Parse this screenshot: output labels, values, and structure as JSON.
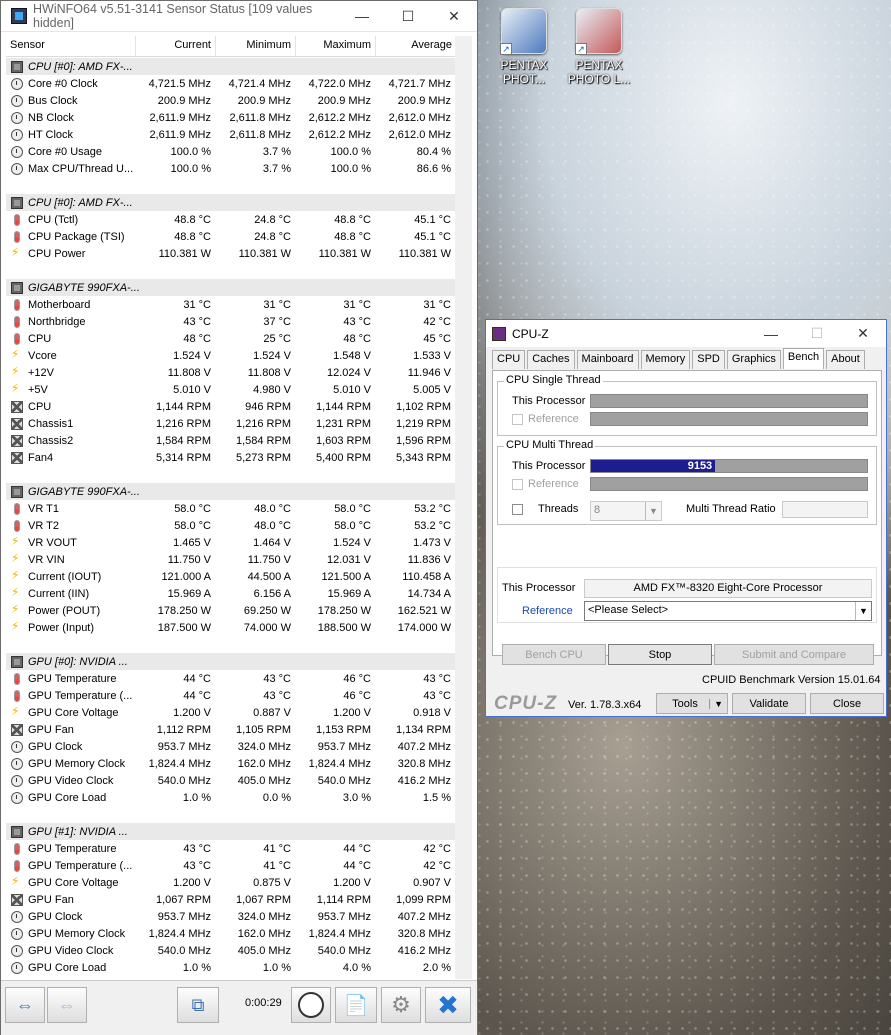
{
  "desktop": {
    "icons": [
      {
        "label": "PENTAX PHOT...",
        "color": "#4c7bbd"
      },
      {
        "label": "PENTAX PHOTO L...",
        "color": "#c45a5a"
      }
    ]
  },
  "hwinfo": {
    "title": "HWiNFO64 v5.51-3141 Sensor Status [109 values hidden]",
    "columns": [
      "Sensor",
      "Current",
      "Minimum",
      "Maximum",
      "Average"
    ],
    "rows": [
      {
        "type": "group",
        "name": "CPU [#0]: AMD FX-..."
      },
      {
        "icon": "clock",
        "name": "Core #0 Clock",
        "cur": "4,721.5 MHz",
        "min": "4,721.4 MHz",
        "max": "4,722.0 MHz",
        "avg": "4,721.7 MHz"
      },
      {
        "icon": "clock",
        "name": "Bus Clock",
        "cur": "200.9 MHz",
        "min": "200.9 MHz",
        "max": "200.9 MHz",
        "avg": "200.9 MHz"
      },
      {
        "icon": "clock",
        "name": "NB Clock",
        "cur": "2,611.9 MHz",
        "min": "2,611.8 MHz",
        "max": "2,612.2 MHz",
        "avg": "2,612.0 MHz"
      },
      {
        "icon": "clock",
        "name": "HT Clock",
        "cur": "2,611.9 MHz",
        "min": "2,611.8 MHz",
        "max": "2,612.2 MHz",
        "avg": "2,612.0 MHz"
      },
      {
        "icon": "clock",
        "name": "Core #0 Usage",
        "cur": "100.0 %",
        "min": "3.7 %",
        "max": "100.0 %",
        "avg": "80.4 %"
      },
      {
        "icon": "clock",
        "name": "Max CPU/Thread U...",
        "cur": "100.0 %",
        "min": "3.7 %",
        "max": "100.0 %",
        "avg": "86.6 %"
      },
      {
        "type": "spacer"
      },
      {
        "type": "group",
        "name": "CPU [#0]: AMD FX-..."
      },
      {
        "icon": "temp",
        "name": "CPU (Tctl)",
        "cur": "48.8 °C",
        "min": "24.8 °C",
        "max": "48.8 °C",
        "avg": "45.1 °C"
      },
      {
        "icon": "temp",
        "name": "CPU Package (TSI)",
        "cur": "48.8 °C",
        "min": "24.8 °C",
        "max": "48.8 °C",
        "avg": "45.1 °C"
      },
      {
        "icon": "volt",
        "name": "CPU Power",
        "cur": "110.381 W",
        "min": "110.381 W",
        "max": "110.381 W",
        "avg": "110.381 W"
      },
      {
        "type": "spacer"
      },
      {
        "type": "group",
        "name": "GIGABYTE 990FXA-..."
      },
      {
        "icon": "temp",
        "name": "Motherboard",
        "cur": "31 °C",
        "min": "31 °C",
        "max": "31 °C",
        "avg": "31 °C"
      },
      {
        "icon": "temp",
        "name": "Northbridge",
        "cur": "43 °C",
        "min": "37 °C",
        "max": "43 °C",
        "avg": "42 °C"
      },
      {
        "icon": "temp",
        "name": "CPU",
        "cur": "48 °C",
        "min": "25 °C",
        "max": "48 °C",
        "avg": "45 °C"
      },
      {
        "icon": "volt",
        "name": "Vcore",
        "cur": "1.524 V",
        "min": "1.524 V",
        "max": "1.548 V",
        "avg": "1.533 V"
      },
      {
        "icon": "volt",
        "name": "+12V",
        "cur": "11.808 V",
        "min": "11.808 V",
        "max": "12.024 V",
        "avg": "11.946 V"
      },
      {
        "icon": "volt",
        "name": "+5V",
        "cur": "5.010 V",
        "min": "4.980 V",
        "max": "5.010 V",
        "avg": "5.005 V"
      },
      {
        "icon": "fan",
        "name": "CPU",
        "cur": "1,144 RPM",
        "min": "946 RPM",
        "max": "1,144 RPM",
        "avg": "1,102 RPM"
      },
      {
        "icon": "fan",
        "name": "Chassis1",
        "cur": "1,216 RPM",
        "min": "1,216 RPM",
        "max": "1,231 RPM",
        "avg": "1,219 RPM"
      },
      {
        "icon": "fan",
        "name": "Chassis2",
        "cur": "1,584 RPM",
        "min": "1,584 RPM",
        "max": "1,603 RPM",
        "avg": "1,596 RPM"
      },
      {
        "icon": "fan",
        "name": "Fan4",
        "cur": "5,314 RPM",
        "min": "5,273 RPM",
        "max": "5,400 RPM",
        "avg": "5,343 RPM"
      },
      {
        "type": "spacer"
      },
      {
        "type": "group",
        "name": "GIGABYTE 990FXA-..."
      },
      {
        "icon": "temp",
        "name": "VR T1",
        "cur": "58.0 °C",
        "min": "48.0 °C",
        "max": "58.0 °C",
        "avg": "53.2 °C"
      },
      {
        "icon": "temp",
        "name": "VR T2",
        "cur": "58.0 °C",
        "min": "48.0 °C",
        "max": "58.0 °C",
        "avg": "53.2 °C"
      },
      {
        "icon": "volt",
        "name": "VR VOUT",
        "cur": "1.465 V",
        "min": "1.464 V",
        "max": "1.524 V",
        "avg": "1.473 V"
      },
      {
        "icon": "volt",
        "name": "VR VIN",
        "cur": "11.750 V",
        "min": "11.750 V",
        "max": "12.031 V",
        "avg": "11.836 V"
      },
      {
        "icon": "volt",
        "name": "Current (IOUT)",
        "cur": "121.000 A",
        "min": "44.500 A",
        "max": "121.500 A",
        "avg": "110.458 A"
      },
      {
        "icon": "volt",
        "name": "Current (IIN)",
        "cur": "15.969 A",
        "min": "6.156 A",
        "max": "15.969 A",
        "avg": "14.734 A"
      },
      {
        "icon": "volt",
        "name": "Power (POUT)",
        "cur": "178.250 W",
        "min": "69.250 W",
        "max": "178.250 W",
        "avg": "162.521 W"
      },
      {
        "icon": "volt",
        "name": "Power (Input)",
        "cur": "187.500 W",
        "min": "74.000 W",
        "max": "188.500 W",
        "avg": "174.000 W"
      },
      {
        "type": "spacer"
      },
      {
        "type": "group",
        "name": "GPU [#0]: NVIDIA ..."
      },
      {
        "icon": "temp",
        "name": "GPU Temperature",
        "cur": "44 °C",
        "min": "43 °C",
        "max": "46 °C",
        "avg": "43 °C"
      },
      {
        "icon": "temp",
        "name": "GPU Temperature (...",
        "cur": "44 °C",
        "min": "43 °C",
        "max": "46 °C",
        "avg": "43 °C"
      },
      {
        "icon": "volt",
        "name": "GPU Core Voltage",
        "cur": "1.200 V",
        "min": "0.887 V",
        "max": "1.200 V",
        "avg": "0.918 V"
      },
      {
        "icon": "fan",
        "name": "GPU Fan",
        "cur": "1,112 RPM",
        "min": "1,105 RPM",
        "max": "1,153 RPM",
        "avg": "1,134 RPM"
      },
      {
        "icon": "clock",
        "name": "GPU Clock",
        "cur": "953.7 MHz",
        "min": "324.0 MHz",
        "max": "953.7 MHz",
        "avg": "407.2 MHz"
      },
      {
        "icon": "clock",
        "name": "GPU Memory Clock",
        "cur": "1,824.4 MHz",
        "min": "162.0 MHz",
        "max": "1,824.4 MHz",
        "avg": "320.8 MHz"
      },
      {
        "icon": "clock",
        "name": "GPU Video Clock",
        "cur": "540.0 MHz",
        "min": "405.0 MHz",
        "max": "540.0 MHz",
        "avg": "416.2 MHz"
      },
      {
        "icon": "clock",
        "name": "GPU Core Load",
        "cur": "1.0 %",
        "min": "0.0 %",
        "max": "3.0 %",
        "avg": "1.5 %"
      },
      {
        "type": "spacer"
      },
      {
        "type": "group",
        "name": "GPU [#1]: NVIDIA ..."
      },
      {
        "icon": "temp",
        "name": "GPU Temperature",
        "cur": "43 °C",
        "min": "41 °C",
        "max": "44 °C",
        "avg": "42 °C"
      },
      {
        "icon": "temp",
        "name": "GPU Temperature (...",
        "cur": "43 °C",
        "min": "41 °C",
        "max": "44 °C",
        "avg": "42 °C"
      },
      {
        "icon": "volt",
        "name": "GPU Core Voltage",
        "cur": "1.200 V",
        "min": "0.875 V",
        "max": "1.200 V",
        "avg": "0.907 V"
      },
      {
        "icon": "fan",
        "name": "GPU Fan",
        "cur": "1,067 RPM",
        "min": "1,067 RPM",
        "max": "1,114 RPM",
        "avg": "1,099 RPM"
      },
      {
        "icon": "clock",
        "name": "GPU Clock",
        "cur": "953.7 MHz",
        "min": "324.0 MHz",
        "max": "953.7 MHz",
        "avg": "407.2 MHz"
      },
      {
        "icon": "clock",
        "name": "GPU Memory Clock",
        "cur": "1,824.4 MHz",
        "min": "162.0 MHz",
        "max": "1,824.4 MHz",
        "avg": "320.8 MHz"
      },
      {
        "icon": "clock",
        "name": "GPU Video Clock",
        "cur": "540.0 MHz",
        "min": "405.0 MHz",
        "max": "540.0 MHz",
        "avg": "416.2 MHz"
      },
      {
        "icon": "clock",
        "name": "GPU Core Load",
        "cur": "1.0 %",
        "min": "1.0 %",
        "max": "4.0 %",
        "avg": "2.0 %"
      }
    ],
    "timer": "0:00:29"
  },
  "cpuz": {
    "title": "CPU-Z",
    "tabs": [
      "CPU",
      "Caches",
      "Mainboard",
      "Memory",
      "SPD",
      "Graphics",
      "Bench",
      "About"
    ],
    "active_tab": "Bench",
    "single": {
      "legend": "CPU Single Thread",
      "this": "This Processor",
      "ref": "Reference"
    },
    "multi": {
      "legend": "CPU Multi Thread",
      "this": "This Processor",
      "ref": "Reference",
      "score": "9153",
      "fill_fraction": 0.45,
      "threads_label": "Threads",
      "threads_value": "8",
      "ratio_label": "Multi Thread Ratio"
    },
    "proc_label": "This Processor",
    "proc_value": "AMD FX™-8320 Eight-Core Processor",
    "ref_label": "Reference",
    "ref_select": "<Please Select>",
    "buttons": {
      "bench": "Bench CPU",
      "stop": "Stop",
      "submit": "Submit and Compare"
    },
    "version_text": "CPUID Benchmark Version 15.01.64",
    "footer": {
      "logo": "CPU-Z",
      "ver": "Ver. 1.78.3.x64",
      "tools": "Tools",
      "validate": "Validate",
      "close": "Close"
    },
    "accent": "#1d1d8f"
  }
}
